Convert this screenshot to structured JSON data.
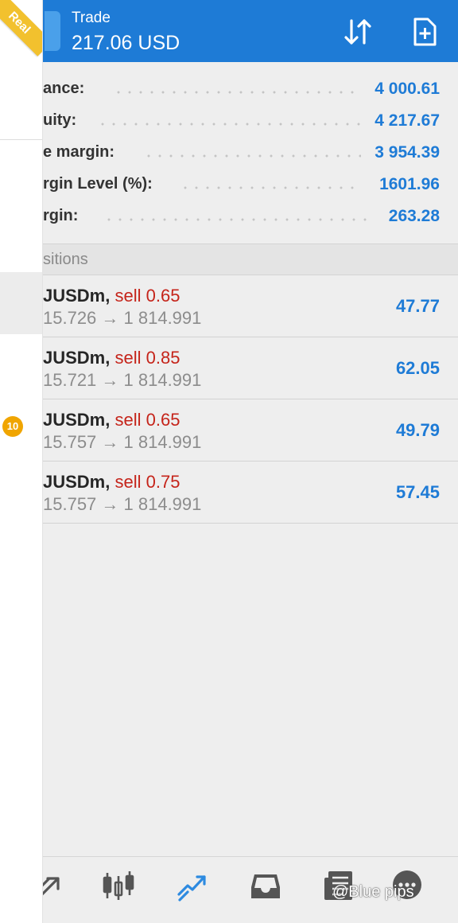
{
  "drawer": {
    "ribbon_label": "Real",
    "badge_count": "10"
  },
  "header": {
    "title": "Trade",
    "subtitle": "217.06 USD",
    "sort_icon": "sort-arrows-icon",
    "new_order_icon": "new-order-icon"
  },
  "summary": [
    {
      "label": "ance:",
      "value": "4 000.61"
    },
    {
      "label": "uity:",
      "value": "4 217.67"
    },
    {
      "label": "e margin:",
      "value": "3 954.39"
    },
    {
      "label": "rgin Level (%):",
      "value": "1601.96"
    },
    {
      "label": "rgin:",
      "value": "263.28"
    }
  ],
  "section_label": "sitions",
  "positions": [
    {
      "symbol": "JUSDm,",
      "side": "sell 0.65",
      "prices": "15.726 → 1 814.991",
      "profit": "47.77"
    },
    {
      "symbol": "JUSDm,",
      "side": "sell 0.85",
      "prices": "15.721 → 1 814.991",
      "profit": "62.05"
    },
    {
      "symbol": "JUSDm,",
      "side": "sell 0.65",
      "prices": "15.757 → 1 814.991",
      "profit": "49.79"
    },
    {
      "symbol": "JUSDm,",
      "side": "sell 0.75",
      "prices": "15.757 → 1 814.991",
      "profit": "57.45"
    }
  ],
  "bottom_nav": [
    {
      "name": "quotes-icon"
    },
    {
      "name": "chart-candles-icon"
    },
    {
      "name": "trade-icon",
      "active": true
    },
    {
      "name": "history-inbox-icon"
    },
    {
      "name": "news-icon"
    },
    {
      "name": "chat-icon"
    }
  ],
  "watermark": "@Blue pips",
  "colors": {
    "accent": "#1e7bd6",
    "sell": "#c5241a",
    "badge": "#f0a500",
    "ribbon": "#f2c12e"
  }
}
